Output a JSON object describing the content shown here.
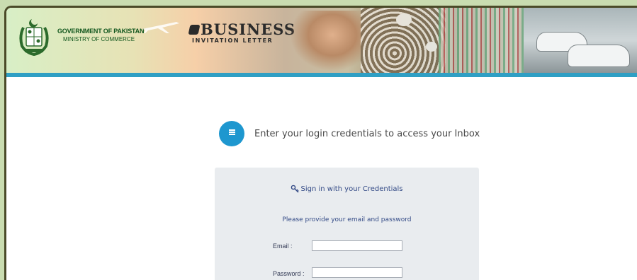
{
  "banner": {
    "gov_title": "GOVERNMENT OF PAKISTAN",
    "gov_subtitle": "MINISTRY OF COMMERCE",
    "brand_main": "BUSINESS",
    "brand_sub": "INVITATION LETTER",
    "strip_color": "#2f9fc4"
  },
  "login": {
    "intro_text": "Enter your login credentials to access your Inbox",
    "signin_heading": "Sign in with your Credentials",
    "instructions": "Please provide your email and password",
    "email_label": "Email :",
    "email_value": "",
    "password_label": "Password :",
    "password_value": "",
    "accent_color": "#1e97cf"
  }
}
